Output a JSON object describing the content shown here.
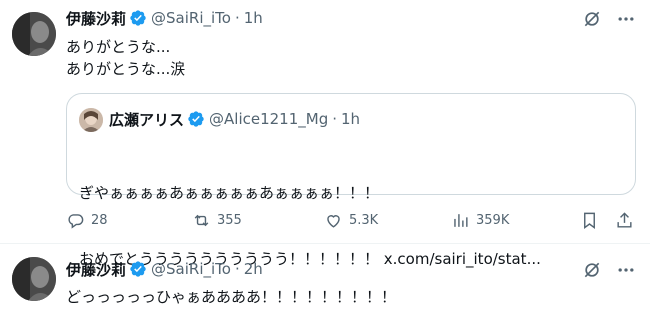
{
  "tweet1": {
    "display_name": "伊藤沙莉",
    "handle": "@SaiRi_iTo",
    "dot": "·",
    "time": "1h",
    "text_line1": "ありがとうな...",
    "text_line2": "ありがとうな...涙",
    "quote": {
      "display_name": "広瀬アリス",
      "handle": "@Alice1211_Mg",
      "dot": "·",
      "time": "1h",
      "text_line1": "ぎやぁぁぁぁあぁぁぁぁぁあぁぁぁぁ！！！",
      "text_line2": "おめでとうううううううううう！！！！！！ x.com/sairi_ito/stat..."
    },
    "actions": {
      "replies": "28",
      "reposts": "355",
      "likes": "5.3K",
      "views": "359K"
    }
  },
  "tweet2": {
    "display_name": "伊藤沙莉",
    "handle": "@SaiRi_iTo",
    "dot": "·",
    "time": "2h",
    "text_line1": "どっっっっっひゃぁああああ！！！！！！！！！"
  },
  "colors": {
    "verified": "#1d9bf0",
    "secondary_text": "#536471",
    "primary_text": "#0f1419",
    "border": "#cfd9de"
  },
  "icons": [
    "grok-icon",
    "more-icon",
    "reply-icon",
    "repost-icon",
    "like-icon",
    "views-icon",
    "bookmark-icon",
    "share-icon",
    "verified-badge-icon"
  ]
}
